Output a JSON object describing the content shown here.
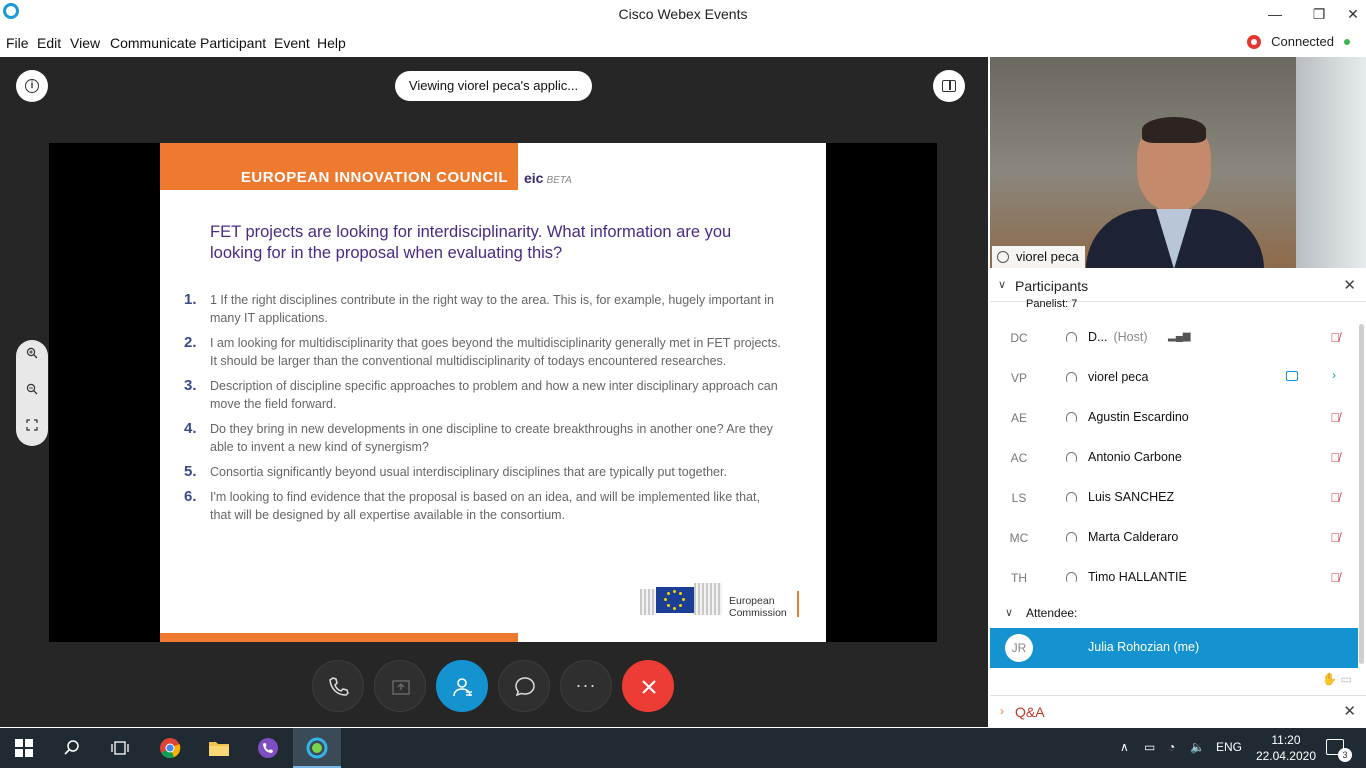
{
  "window": {
    "title": "Cisco Webex Events",
    "minimize": "—",
    "restore": "❐",
    "close": "✕"
  },
  "menu": [
    "File",
    "Edit",
    "View",
    "Communicate",
    "Participant",
    "Event",
    "Help"
  ],
  "status": {
    "connected_label": "Connected"
  },
  "stage": {
    "viewing_label": "Viewing viorel peca's applic...",
    "info_icon": "info-icon",
    "layout_icon": "layout-icon"
  },
  "slide": {
    "header": "EUROPEAN INNOVATION COUNCIL",
    "logo": "eic",
    "logo_beta": "BETA",
    "title": "FET projects are looking for interdisciplinarity. What information are you looking for in the proposal when evaluating this?",
    "items": [
      {
        "num": "1.",
        "text": "1  If the right disciplines contribute in the right way to the area. This is, for example, hugely important in many IT applications."
      },
      {
        "num": "2.",
        "text": "I am looking for multidisciplinarity that goes beyond the multidisciplinarity generally met in FET  projects. It should be larger than the conventional multidisciplinarity of todays encountered researches."
      },
      {
        "num": "3.",
        "text": "Description of discipline specific approaches to problem and how a new inter disciplinary approach can move the field forward."
      },
      {
        "num": "4.",
        "text": "Do they bring in new developments in one discipline to create breakthroughs in another one? Are they able to invent a new kind of synergism?"
      },
      {
        "num": "5.",
        "text": "Consortia significantly beyond usual interdisciplinary disciplines that are typically put together."
      },
      {
        "num": "6.",
        "text": " I'm looking to find evidence that the proposal is based on an idea, and will be implemented like that, that will be designed by all expertise available in the consortium."
      }
    ],
    "ec_line1": "European",
    "ec_line2": "Commission"
  },
  "zoom": {
    "in": "+",
    "out": "−",
    "fit": "⛶"
  },
  "controls": {
    "more_label": "···"
  },
  "video": {
    "speaker_name": "viorel peca"
  },
  "participants": {
    "title": "Participants",
    "panelist_label": "Panelist: 7",
    "attendee_label": "Attendee:",
    "host_tag": "(Host)",
    "panelists": [
      {
        "initials": "DC",
        "name": "D...",
        "host": true,
        "state": "muted"
      },
      {
        "initials": "VP",
        "name": "viorel peca",
        "host": false,
        "state": "video"
      },
      {
        "initials": "AE",
        "name": "Agustin Escardino",
        "host": false,
        "state": "muted"
      },
      {
        "initials": "AC",
        "name": "Antonio Carbone",
        "host": false,
        "state": "muted"
      },
      {
        "initials": "LS",
        "name": "Luis SANCHEZ",
        "host": false,
        "state": "muted"
      },
      {
        "initials": "MC",
        "name": "Marta Calderaro",
        "host": false,
        "state": "muted"
      },
      {
        "initials": "TH",
        "name": "Timo HALLANTIE",
        "host": false,
        "state": "muted"
      }
    ],
    "attendees": [
      {
        "initials": "JR",
        "name": "Julia Rohozian  (me)"
      }
    ]
  },
  "qa": {
    "label": "Q&A"
  },
  "taskbar": {
    "language": "ENG",
    "time": "11:20",
    "date": "22.04.2020",
    "notification_count": "3"
  },
  "colors": {
    "accent": "#1593d0",
    "eic_orange": "#ee7a30",
    "end_call": "#ed3b36",
    "muted_red": "#d9383a",
    "connected_green": "#3cb650"
  }
}
